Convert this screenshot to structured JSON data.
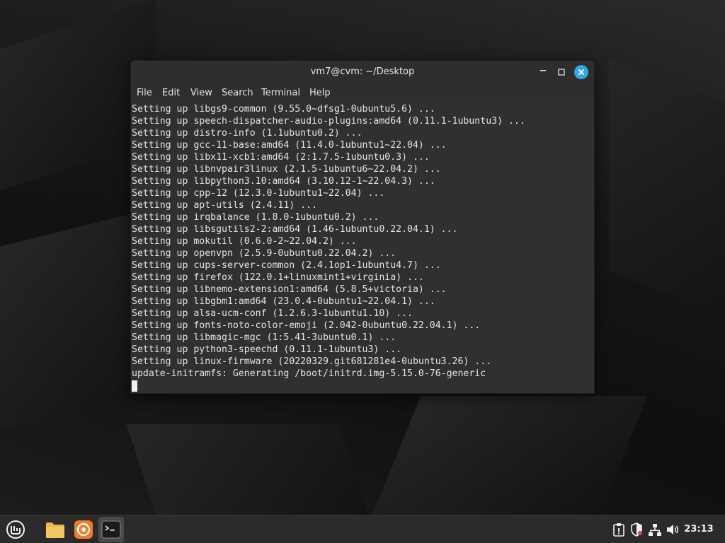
{
  "window": {
    "title": "vm7@cvm: ~/Desktop",
    "menu": [
      "File",
      "Edit",
      "View",
      "Search",
      "Terminal",
      "Help"
    ]
  },
  "terminal": {
    "lines": [
      "Setting up libgs9-common (9.55.0~dfsg1-0ubuntu5.6) ...",
      "Setting up speech-dispatcher-audio-plugins:amd64 (0.11.1-1ubuntu3) ...",
      "Setting up distro-info (1.1ubuntu0.2) ...",
      "Setting up gcc-11-base:amd64 (11.4.0-1ubuntu1~22.04) ...",
      "Setting up libx11-xcb1:amd64 (2:1.7.5-1ubuntu0.3) ...",
      "Setting up libnvpair3linux (2.1.5-1ubuntu6~22.04.2) ...",
      "Setting up libpython3.10:amd64 (3.10.12-1~22.04.3) ...",
      "Setting up cpp-12 (12.3.0-1ubuntu1~22.04) ...",
      "Setting up apt-utils (2.4.11) ...",
      "Setting up irqbalance (1.8.0-1ubuntu0.2) ...",
      "Setting up libsgutils2-2:amd64 (1.46-1ubuntu0.22.04.1) ...",
      "Setting up mokutil (0.6.0-2~22.04.2) ...",
      "Setting up openvpn (2.5.9-0ubuntu0.22.04.2) ...",
      "Setting up cups-server-common (2.4.1op1-1ubuntu4.7) ...",
      "Setting up firefox (122.0.1+linuxmint1+virginia) ...",
      "Setting up libnemo-extension1:amd64 (5.8.5+victoria) ...",
      "Setting up libgbm1:amd64 (23.0.4-0ubuntu1~22.04.1) ...",
      "Setting up alsa-ucm-conf (1.2.6.3-1ubuntu1.10) ...",
      "Setting up fonts-noto-color-emoji (2.042-0ubuntu0.22.04.1) ...",
      "Setting up libmagic-mgc (1:5.41-3ubuntu0.1) ...",
      "Setting up python3-speechd (0.11.1-1ubuntu3) ...",
      "Setting up linux-firmware (20220329.git681281e4-0ubuntu3.26) ...",
      "update-initramfs: Generating /boot/initrd.img-5.15.0-76-generic"
    ]
  },
  "taskbar": {
    "icons": [
      "mint-menu-icon",
      "folder-icon",
      "firefox-icon",
      "terminal-icon"
    ],
    "tray": [
      "clipboard-icon",
      "shield-icon",
      "network-icon",
      "volume-icon"
    ],
    "clock": "23:13"
  },
  "colors": {
    "accent": "#35a8e0",
    "terminal_bg": "#303030",
    "taskbar_bg": "#2b2b2b",
    "folder": "#e9b949",
    "firefox": "#f57a26"
  }
}
